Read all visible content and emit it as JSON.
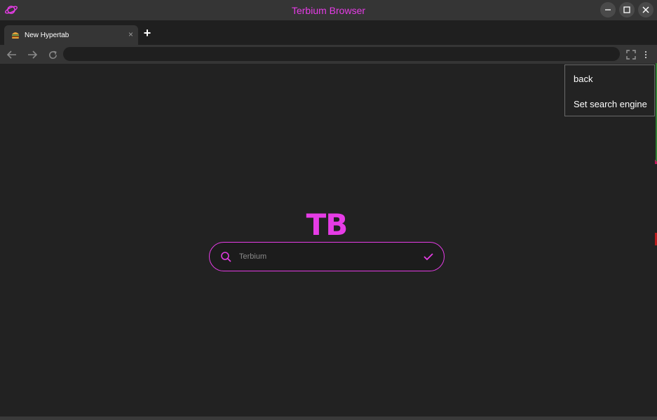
{
  "window": {
    "title": "Terbium Browser",
    "app_icon": "planet-icon",
    "accent_color": "#e63ce6"
  },
  "tabs": [
    {
      "title": "New Hypertab",
      "favicon": "burger-favicon",
      "close_glyph": "×"
    }
  ],
  "new_tab_glyph": "+",
  "toolbar": {
    "back_icon": "arrow-left-icon",
    "forward_icon": "arrow-right-icon",
    "reload_icon": "reload-icon",
    "address_value": "",
    "fullscreen_icon": "fullscreen-icon",
    "menu_icon": "kebab-menu-icon"
  },
  "home": {
    "logo": "TB",
    "search_placeholder": "Terbium",
    "search_value": ""
  },
  "menu": {
    "items": [
      "back",
      "Set search engine"
    ]
  }
}
